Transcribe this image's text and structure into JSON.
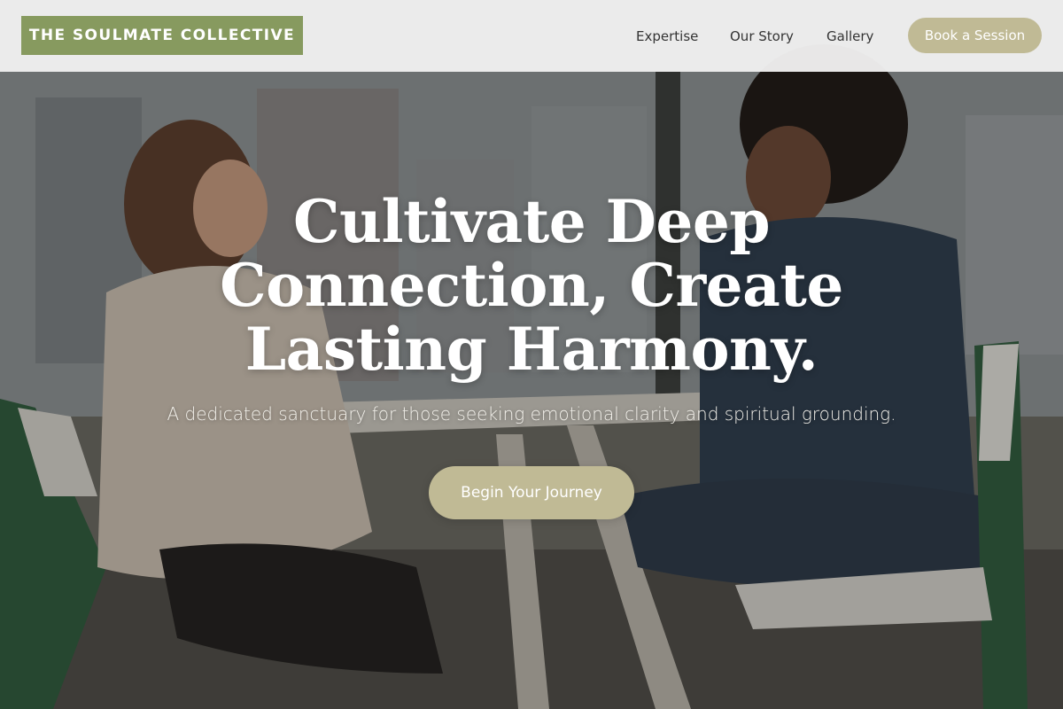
{
  "header": {
    "brand": "THE SOULMATE COLLECTIVE",
    "nav": [
      "Expertise",
      "Our Story",
      "Gallery"
    ],
    "cta_label": "Book a Session"
  },
  "hero": {
    "headline_lines": [
      "Cultivate Deep",
      "Connection, Create",
      "Lasting Harmony."
    ],
    "tagline": "A dedicated sanctuary for those seeking emotional clarity and spiritual grounding.",
    "button_label": "Begin Your Journey",
    "background": "photo of two women talking at a table in front of a city window"
  },
  "colors": {
    "brand_green": "#879a5f",
    "accent_khaki": "#c0ba95",
    "header_bg": "#f0f0f0",
    "text_dark": "#333333"
  }
}
